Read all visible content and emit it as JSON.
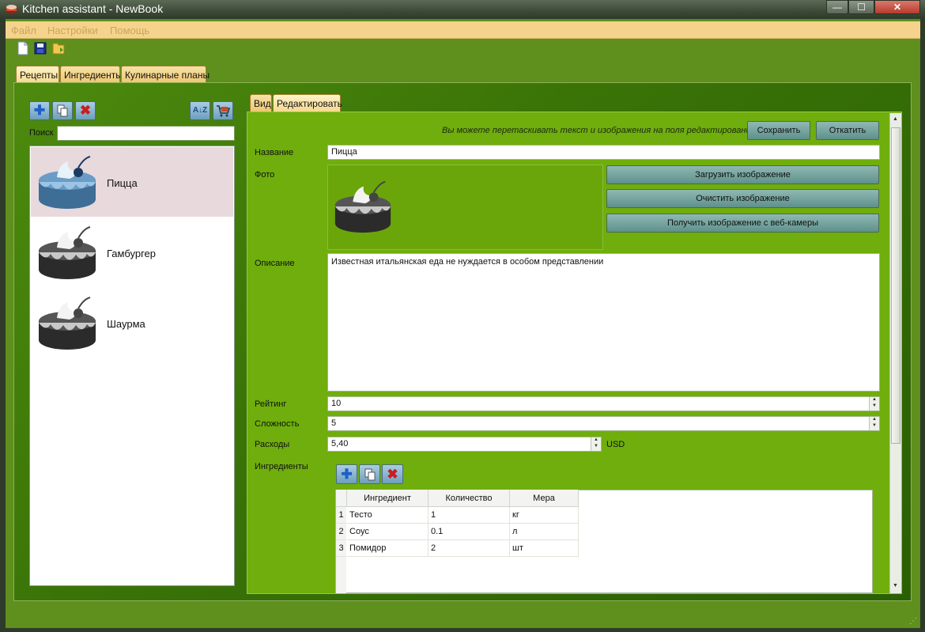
{
  "window": {
    "title": "Kitchen assistant - NewBook",
    "min_label": "—",
    "max_label": "☐",
    "close_label": "✕"
  },
  "menu": {
    "file": "Файл",
    "settings": "Настройки",
    "help": "Помощь"
  },
  "main_tabs": [
    "Рецепты",
    "Ингредиенты",
    "Кулинарные планы"
  ],
  "left": {
    "search_label": "Поиск",
    "search_value": "",
    "recipes": [
      {
        "name": "Пицца",
        "selected": true
      },
      {
        "name": "Гамбургер",
        "selected": false
      },
      {
        "name": "Шаурма",
        "selected": false
      }
    ]
  },
  "edit_tabs": [
    "Вид",
    "Редактировать"
  ],
  "editor": {
    "hint": "Вы можете перетаскивать текст и изображения на поля редактирования",
    "save": "Сохранить",
    "revert": "Откатить",
    "name_label": "Название",
    "name_value": "Пицца",
    "photo_label": "Фото",
    "load_image": "Загрузить изображение",
    "clear_image": "Очистить изображение",
    "webcam_image": "Получить изображение с веб-камеры",
    "desc_label": "Описание",
    "desc_value": "Известная итальянская еда не нуждается в особом представлении",
    "rating_label": "Рейтинг",
    "rating_value": "10",
    "difficulty_label": "Сложность",
    "difficulty_value": "5",
    "cost_label": "Расходы",
    "cost_value": "5,40",
    "currency": "USD",
    "ingredients_label": "Ингредиенты"
  },
  "ingredients_table": {
    "headers": [
      "Ингредиент",
      "Количество",
      "Мера"
    ],
    "rows": [
      {
        "num": "1",
        "ingredient": "Тесто",
        "qty": "1",
        "unit": "кг"
      },
      {
        "num": "2",
        "ingredient": "Соус",
        "qty": "0.1",
        "unit": "л"
      },
      {
        "num": "3",
        "ingredient": "Помидор",
        "qty": "2",
        "unit": "шт"
      }
    ]
  },
  "colors": {
    "accent_green": "#6fae0c",
    "tab_yellow": "#f5d98e",
    "selected_row": "#e8d9dc"
  }
}
